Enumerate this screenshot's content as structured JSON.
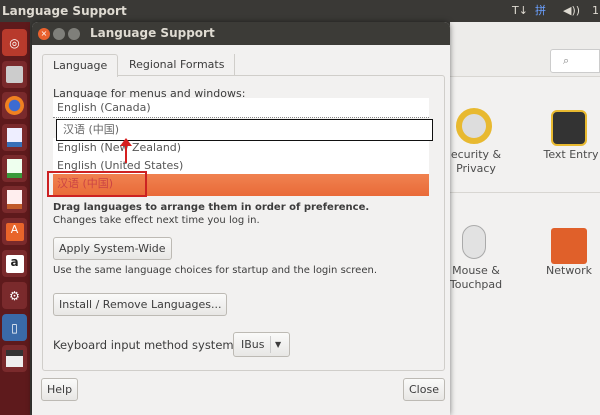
{
  "topbar": {
    "app_title": "Language Support",
    "tray": {
      "keyboard": "T↓",
      "input_method": "拼",
      "volume": "◀))",
      "clock": "1"
    }
  },
  "launcher": {
    "items": [
      "Ubuntu Dash",
      "Files",
      "Firefox",
      "LibreOffice Writer",
      "LibreOffice Calc",
      "LibreOffice Impress",
      "Ubuntu Software",
      "Amazon",
      "System Settings",
      "Language Support",
      "Save"
    ]
  },
  "settings": {
    "search_icon": "search-icon",
    "items": [
      {
        "label": "ecurity &\nPrivacy"
      },
      {
        "label": "Text Entry"
      },
      {
        "label": "Mouse &\nTouchpad"
      },
      {
        "label": "Network"
      }
    ]
  },
  "dialog": {
    "title": "Language Support",
    "tabs": [
      {
        "label": "Language",
        "active": true
      },
      {
        "label": "Regional Formats",
        "active": false
      }
    ],
    "list_label": "Language for menus and windows:",
    "languages": [
      "English (Canada)",
      "English (New Zealand)",
      "English (United States)",
      "汉语 (中国)"
    ],
    "drag_item": "汉语 (中国)",
    "drag_hint": "Drag languages to arrange them in order of preference.",
    "changes_note": "Changes take effect next time you log in.",
    "apply_button": "Apply System-Wide",
    "apply_note": "Use the same language choices for startup and the login screen.",
    "install_button": "Install / Remove Languages...",
    "im_label": "Keyboard input method system:",
    "im_value": "IBus",
    "help_button": "Help",
    "close_button": "Close",
    "colors": {
      "selected": "#ef7442",
      "annotation": "#d62020"
    }
  }
}
